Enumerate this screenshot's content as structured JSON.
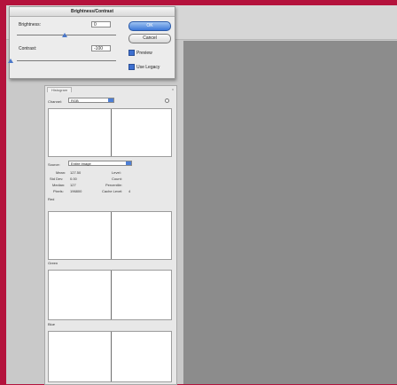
{
  "dialog": {
    "title": "Brightness/Contrast",
    "brightness_label": "Brightness:",
    "brightness_value": "0",
    "contrast_label": "Contrast:",
    "contrast_value": "-100",
    "ok_label": "OK",
    "cancel_label": "Cancel",
    "preview_label": "Preview",
    "preview_checked": true,
    "use_legacy_label": "Use Legacy",
    "use_legacy_checked": true
  },
  "histogram": {
    "tab_label": "Histogram",
    "close_label": "x",
    "channel_label": "Channel:",
    "channel_value": "RGB",
    "source_label": "Source:",
    "source_value": "Entire Image",
    "stats": {
      "mean_label": "Mean:",
      "mean_value": "127.50",
      "stddev_label": "Std Dev:",
      "stddev_value": "0.00",
      "median_label": "Median:",
      "median_value": "127",
      "pixels_label": "Pixels:",
      "pixels_value": "196800",
      "level_label": "Level:",
      "count_label": "Count:",
      "percentile_label": "Percentile:",
      "cache_label": "Cache Level:",
      "cache_value": "4"
    },
    "channels": [
      "Red",
      "Green",
      "Blue"
    ]
  },
  "colors": {
    "background": "#b4123c",
    "canvas": "#8c8c8c",
    "accent": "#3d78d8"
  }
}
